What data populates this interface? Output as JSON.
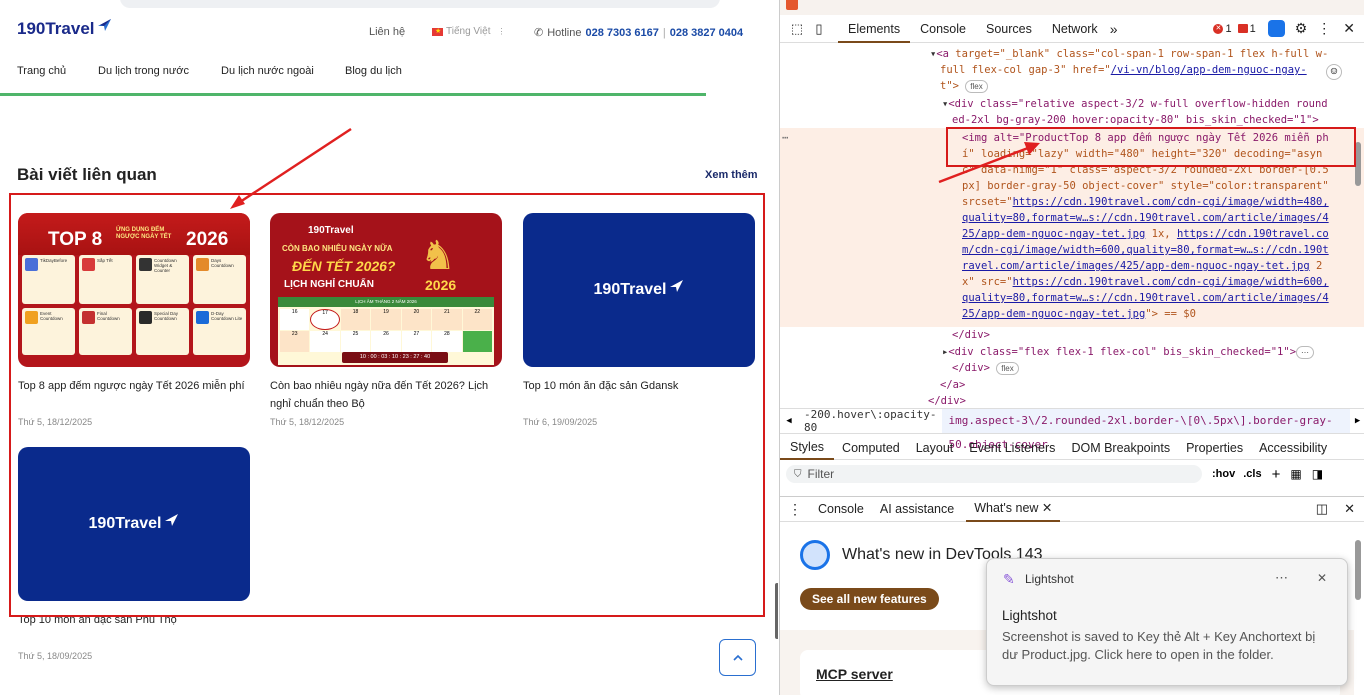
{
  "site": {
    "brand": "190Travel",
    "contact": "Liên hệ",
    "language": "Tiếng Việt",
    "hotline_label": "Hotline",
    "hotline_1": "028 7303 6167",
    "hotline_2": "028 3827 0404",
    "nav": [
      "Trang chủ",
      "Du lịch trong nước",
      "Du lịch nước ngoài",
      "Blog du lịch"
    ],
    "section_title": "Bài viết liên quan",
    "view_more": "Xem thêm",
    "articles": [
      {
        "title": "Top 8 app đếm ngược ngày Tết 2026 miễn phí",
        "date": "Thứ 5, 18/12/2025",
        "image": "tet-apps"
      },
      {
        "title": "Còn bao nhiêu ngày nữa đến Tết 2026? Lịch nghỉ chuẩn theo Bộ",
        "date": "Thứ 5, 18/12/2025",
        "image": "tet-countdown"
      },
      {
        "title": "Top 10 món ăn đặc sản Gdansk",
        "date": "Thứ 6, 19/09/2025",
        "image": "placeholder"
      },
      {
        "title": "Top 10 món ăn đặc sản Phú Thọ",
        "date": "Thứ 5, 18/09/2025",
        "image": "placeholder"
      }
    ],
    "img1": {
      "heading_top": "TOP 8",
      "heading_mid": "ỨNG DỤNG ĐẾM NGƯỢC NGÀY TẾT",
      "year": "2026",
      "apps": [
        "TikDayBefore",
        "Sắp Tết",
        "Countdown Widget & Counter",
        "Days Countdown",
        "Event Countdown",
        "Final Countdown",
        "Special Day Countdown",
        "D-Day Countdown Lite"
      ]
    },
    "img2": {
      "line1": "CÒN BAO NHIÊU NGÀY NỮA",
      "line2": "ĐẾN TẾT 2026?",
      "line3": "LỊCH NGHỈ CHUẨN",
      "year": "2026",
      "cal_title": "LỊCH ÂM THÁNG 2 NĂM 2026",
      "timer": "10 : 00 : 03 : 10 : 23 : 27 : 40",
      "cells": [
        "16",
        "17",
        "18",
        "19",
        "20",
        "21",
        "22",
        "23",
        "24",
        "25",
        "26",
        "27",
        "28",
        ""
      ]
    }
  },
  "devtools": {
    "tabs": [
      "Elements",
      "Console",
      "Sources",
      "Network"
    ],
    "errors": "1",
    "warnings": "1",
    "code": {
      "l1_tag": "<a",
      "l1_attrs": " target=\"_blank\" class=\"col-span-1 row-span-1 flex h-full w-",
      "l2": "full flex-col gap-3\" href=\"",
      "l2_link": "/vi-vn/blog/app-dem-nguoc-ngay-",
      "l3": "t\">",
      "l4": "<div class=\"relative aspect-3/2 w-full overflow-hidden round",
      "l5": "ed-2xl bg-gray-200 hover:opacity-80\" bis_skin_checked=\"1\">",
      "l6": "<img alt=\"ProductTop 8 app đếm ngược ngày Tết 2026 miễn ph",
      "l7": "í\" loading=\"lazy\" width=\"480\" height=\"320\" decoding=\"asyn",
      "l8": "c\" data-nimg=\"1\" class=\"aspect-3/2 rounded-2xl border-[0.5",
      "l9": "px] border-gray-50 object-cover\" style=\"color:transparent\"",
      "l10": "srcset=\"",
      "l10_link": "https://cdn.190travel.com/cdn-cgi/image/width=480,",
      "l11_link": "quality=80,format=w…s://cdn.190travel.com/article/images/4",
      "l12_link": "25/app-dem-nguoc-ngay-tet.jpg",
      "l12_rest": " 1x, ",
      "l12_link2": "https://cdn.190travel.co",
      "l13_link": "m/cdn-cgi/image/width=600,quality=80,format=w…s://cdn.190t",
      "l14_link": "ravel.com/article/images/425/app-dem-nguoc-ngay-tet.jpg",
      "l14_rest": " 2",
      "l15": "x\" src=\"",
      "l15_link": "https://cdn.190travel.com/cdn-cgi/image/width=600,",
      "l16_link": "quality=80,format=w…s://cdn.190travel.com/article/images/4",
      "l17_link": "25/app-dem-nguoc-ngay-tet.jpg",
      "l17_rest": "\"> == $0",
      "l18": "</div>",
      "l19": "<div class=\"flex flex-1 flex-col\" bis_skin_checked=\"1\">",
      "l20": "</div>",
      "l21": "</a>",
      "l22": "</div>",
      "badge": "flex"
    },
    "crumb1": "-200.hover\\:opacity-80",
    "crumb2": "img.aspect-3\\/2.rounded-2xl.border-\\[0\\.5px\\].border-gray-50.object-cover",
    "subtabs": [
      "Styles",
      "Computed",
      "Layout",
      "Event Listeners",
      "DOM Breakpoints",
      "Properties",
      "Accessibility"
    ],
    "filter_placeholder": "Filter",
    "hov": ":hov",
    "cls": ".cls",
    "drawer_tabs": [
      "Console",
      "AI assistance",
      "What's new"
    ],
    "whats_new_title": "What's new in DevTools 143",
    "see_all": "See all new features",
    "mcp": "MCP server"
  },
  "toast": {
    "app": "Lightshot",
    "title": "Lightshot",
    "body": "Screenshot is saved to Key thẻ Alt + Key Anchortext bị dư Product.jpg. Click here to open in the folder."
  },
  "colors": {
    "accent_red": "#d61a1a",
    "brand_blue": "#0a2a8c",
    "devtools_active": "#7a4a1a"
  }
}
